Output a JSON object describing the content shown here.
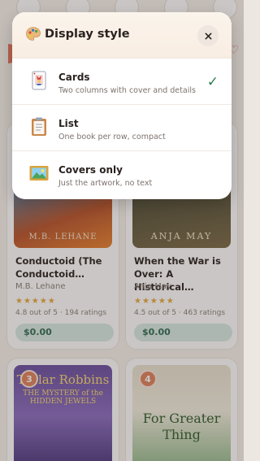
{
  "sheet": {
    "title": "Display style",
    "title_icon": "palette-icon",
    "close_icon": "close-icon",
    "options": [
      {
        "label": "Cards",
        "description": "Two columns with cover and details",
        "icon": "joker-card-icon",
        "selected": true
      },
      {
        "label": "List",
        "description": "One book per row, compact",
        "icon": "clipboard-icon",
        "selected": false
      },
      {
        "label": "Covers only",
        "description": "Just the artwork, no text",
        "icon": "framed-picture-icon",
        "selected": false
      }
    ],
    "check_glyph": "✓"
  },
  "books": [
    {
      "title": "Conductoid (The Conductoid…",
      "author": "M.B. Lehane",
      "stars": "★★★★★",
      "rating": "4.8 out of 5 · 194 ratings",
      "price": "$0.00",
      "cover_author": "M.B. LEHANE"
    },
    {
      "title": "When the War is Over: A Historical…",
      "author": "Anja May",
      "stars": "★★★★★",
      "rating": "4.5 out of 5 · 463 ratings",
      "price": "$0.00",
      "cover_author": "ANJA MAY"
    },
    {
      "rank": "3",
      "cover_title": "Taylar Robbins",
      "cover_subtitle": "THE MYSTERY of the HIDDEN JEWELS"
    },
    {
      "rank": "4",
      "cover_title": "For Greater Thing"
    }
  ],
  "colors": {
    "accent_green": "#2e7d4f",
    "price_bg": "#d9ebe3",
    "rank_badge": "#e0825a",
    "star": "#e8a93a"
  }
}
